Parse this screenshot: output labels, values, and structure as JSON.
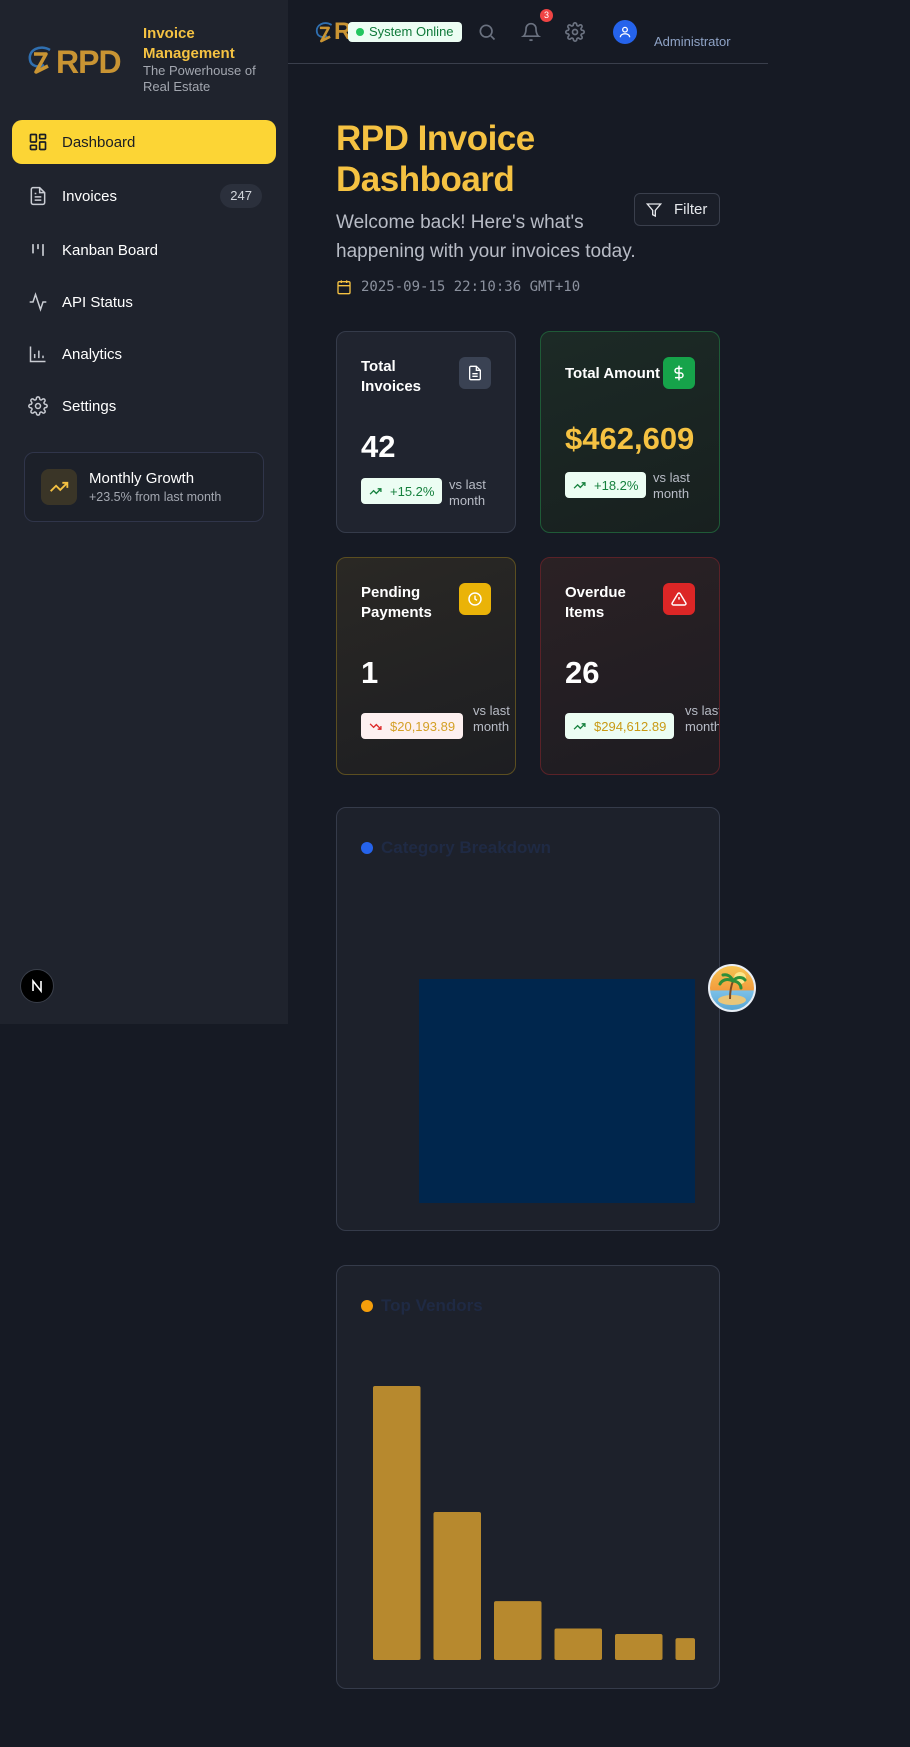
{
  "brand": {
    "logo_text": "RPD",
    "title": "Invoice Management",
    "subtitle": "The Powerhouse of Real Estate"
  },
  "sidebar": {
    "items": [
      {
        "label": "Dashboard",
        "icon": "dashboard-icon",
        "active": true
      },
      {
        "label": "Invoices",
        "icon": "file-text-icon",
        "count": "247"
      },
      {
        "label": "Kanban Board",
        "icon": "kanban-icon"
      },
      {
        "label": "API Status",
        "icon": "activity-icon"
      },
      {
        "label": "Analytics",
        "icon": "bar-chart-icon"
      },
      {
        "label": "Settings",
        "icon": "gear-icon"
      }
    ],
    "growth": {
      "title": "Monthly Growth",
      "subtitle": "+23.5% from last month"
    },
    "badge_letter": "N"
  },
  "topbar": {
    "status": "System Online",
    "notifications": "3",
    "user": "Administrator"
  },
  "header": {
    "title": "RPD Invoice Dashboard",
    "subtitle": "Welcome back! Here's what's happening with your invoices today.",
    "datetime": "2025-09-15 22:10:36 GMT+10",
    "filter_label": "Filter"
  },
  "stats": {
    "total_invoices": {
      "title": "Total Invoices",
      "value": "42",
      "trend": "+15.2%",
      "vs": "vs last month"
    },
    "total_amount": {
      "title": "Total Amount",
      "value": "$462,609",
      "trend": "+18.2%",
      "vs": "vs last month"
    },
    "pending": {
      "title": "Pending Payments",
      "value": "1",
      "trend": "$20,193.89",
      "vs": "vs last month"
    },
    "overdue": {
      "title": "Overdue Items",
      "value": "26",
      "trend": "$294,612.89",
      "vs": "vs last month"
    }
  },
  "colors": {
    "accent": "#fcd535",
    "gold_text": "#f5c242",
    "category_bar": "#00264d",
    "vendor_bar": "#b7892e",
    "green_icon": "#16a34a",
    "red_icon": "#dc2626"
  },
  "chart_data": [
    {
      "type": "bar",
      "title": "Category Breakdown",
      "categories": [
        ""
      ],
      "values": [
        1
      ],
      "ylim": [
        0,
        1
      ]
    },
    {
      "type": "bar",
      "title": "Top Vendors",
      "categories": [
        "",
        "",
        "",
        "",
        "",
        ""
      ],
      "values": [
        100,
        54,
        21.5,
        11.5,
        9.5,
        8
      ],
      "ylim": [
        0,
        100
      ]
    }
  ]
}
